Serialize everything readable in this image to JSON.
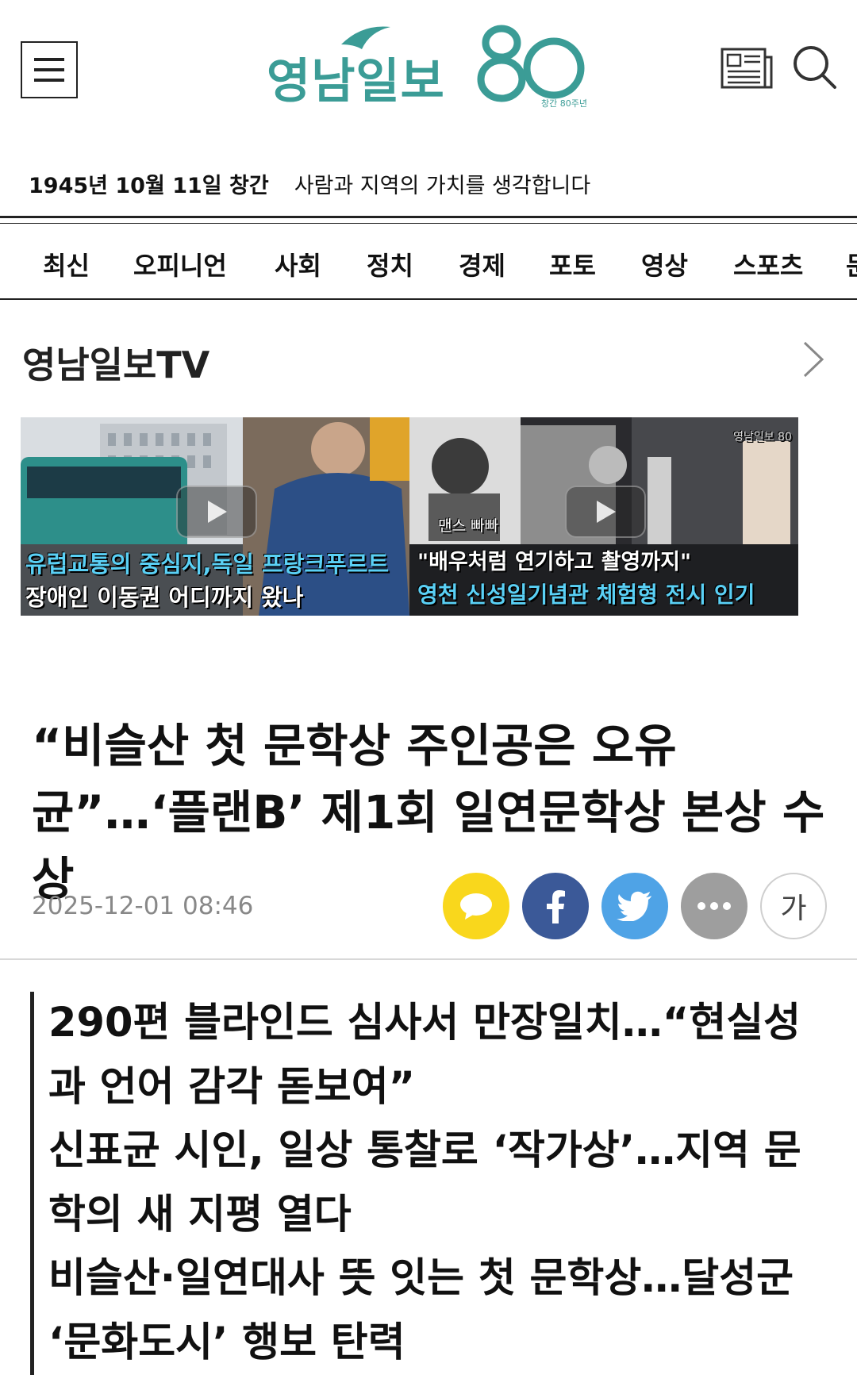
{
  "header": {
    "logo_text": "영남일보",
    "logo_number": "80",
    "logo_tagline": "창간 80주년",
    "slogan_date": "1945년 10월 11일 창간",
    "slogan_text": "사람과 지역의 가치를 생각합니다"
  },
  "nav": {
    "items": [
      "최신",
      "오피니언",
      "사회",
      "정치",
      "경제",
      "포토",
      "영상",
      "스포츠",
      "문"
    ]
  },
  "tv": {
    "title": "영남일보TV",
    "videos": [
      {
        "caption_line1": "유럽교통의 중심지,독일 프랑크푸르트",
        "caption_line2": "장애인 이동권 어디까지 왔나"
      },
      {
        "caption_line1": "\"배우처럼 연기하고 촬영까지\"",
        "caption_line2": "영천 신성일기념관 체험형 전시 인기",
        "overlay_text": "맨스 빠빠",
        "watermark": "영남일보 80"
      }
    ]
  },
  "article": {
    "headline": "“비슬산 첫 문학상 주인공은 오유균”…‘플랜B’ 제1회 일연문학상 본상 수상",
    "datetime": "2025-12-01 08:46",
    "font_size_button": "가",
    "subheadlines": [
      "290편 블라인드 심사서 만장일치…“현실성과 언어 감각 돋보여”",
      "신표균 시인, 일상 통찰로 ‘작가상’…지역 문학의 새 지평 열다",
      "비슬산·일연대사 뜻 잇는 첫 문학상…달성군 ‘문화도시’ 행보 탄력"
    ]
  },
  "colors": {
    "brand": "#3b9c96",
    "kakao": "#f9d71c",
    "facebook": "#3b5998",
    "twitter": "#4fa3e6",
    "more": "#9e9e9e",
    "caption_blue": "#5ad0f5"
  },
  "icons": [
    "menu-icon",
    "newspaper-icon",
    "search-icon",
    "chevron-right-icon",
    "play-icon",
    "speech-bubble-icon",
    "facebook-icon",
    "twitter-icon",
    "more-icon"
  ]
}
